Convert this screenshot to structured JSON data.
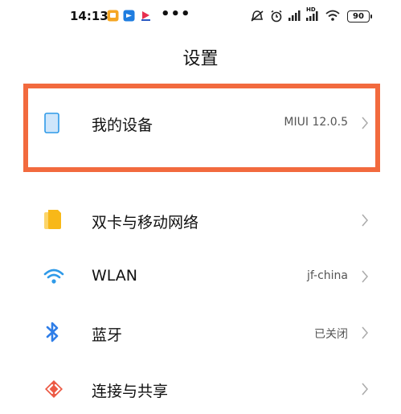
{
  "status_bar": {
    "time": "14:13",
    "dots": "•••",
    "battery": "90",
    "network_type_label": "HD"
  },
  "page": {
    "title": "设置"
  },
  "settings": [
    {
      "label": "我的设备",
      "value": "MIUI 12.0.5",
      "icon": "device-icon"
    },
    {
      "label": "双卡与移动网络",
      "value": "",
      "icon": "sim-card-icon"
    },
    {
      "label": "WLAN",
      "value": "jf-china",
      "icon": "wifi-icon"
    },
    {
      "label": "蓝牙",
      "value": "已关闭",
      "icon": "bluetooth-icon"
    },
    {
      "label": "连接与共享",
      "value": "",
      "icon": "share-icon"
    }
  ],
  "colors": {
    "highlight": "#f26a3e",
    "sim": "#f8b818",
    "wifi": "#2f9ae8",
    "bluetooth": "#2f7ee8",
    "share": "#ec5a45"
  }
}
